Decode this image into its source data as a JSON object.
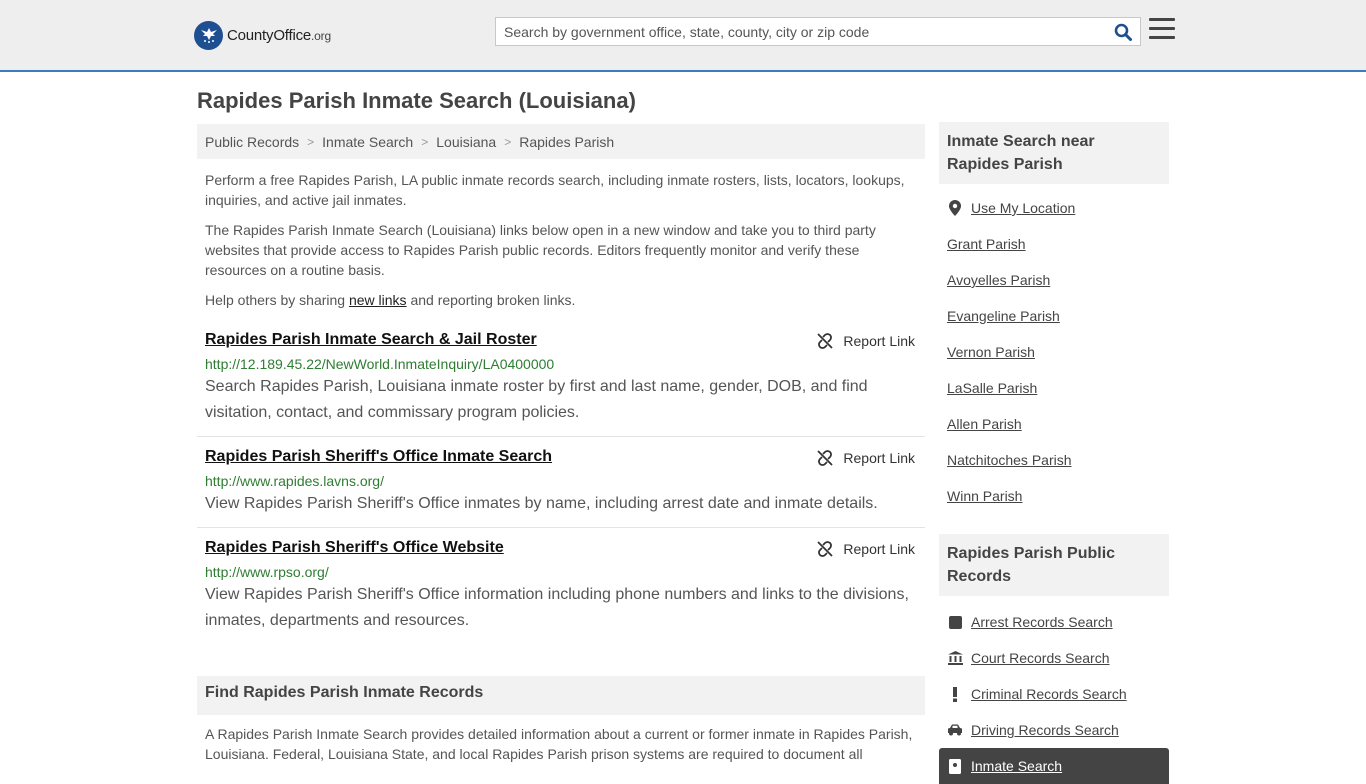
{
  "header": {
    "logo_main": "CountyOffice",
    "logo_tld": ".org",
    "search_placeholder": "Search by government office, state, county, city or zip code"
  },
  "page_title": "Rapides Parish Inmate Search (Louisiana)",
  "breadcrumb": [
    "Public Records",
    "Inmate Search",
    "Louisiana",
    "Rapides Parish"
  ],
  "intro": {
    "p1": "Perform a free Rapides Parish, LA public inmate records search, including inmate rosters, lists, locators, lookups, inquiries, and active jail inmates.",
    "p2": "The Rapides Parish Inmate Search (Louisiana) links below open in a new window and take you to third party websites that provide access to Rapides Parish public records. Editors frequently monitor and verify these resources on a routine basis.",
    "p3_before": "Help others by sharing ",
    "p3_link": "new links",
    "p3_after": " and reporting broken links."
  },
  "report_label": "Report Link",
  "results": [
    {
      "title": "Rapides Parish Inmate Search & Jail Roster",
      "url": "http://12.189.45.22/NewWorld.InmateInquiry/LA0400000",
      "desc": "Search Rapides Parish, Louisiana inmate roster by first and last name, gender, DOB, and find visitation, contact, and commissary program policies."
    },
    {
      "title": "Rapides Parish Sheriff's Office Inmate Search",
      "url": "http://www.rapides.lavns.org/",
      "desc": "View Rapides Parish Sheriff's Office inmates by name, including arrest date and inmate details."
    },
    {
      "title": "Rapides Parish Sheriff's Office Website",
      "url": "http://www.rpso.org/",
      "desc": "View Rapides Parish Sheriff's Office information including phone numbers and links to the divisions, inmates, departments and resources."
    }
  ],
  "find_section": {
    "heading": "Find Rapides Parish Inmate Records",
    "body": "A Rapides Parish Inmate Search provides detailed information about a current or former inmate in Rapides Parish, Louisiana. Federal, Louisiana State, and local Rapides Parish prison systems are required to document all"
  },
  "sidebar": {
    "nearby_heading": "Inmate Search near Rapides Parish",
    "use_location": "Use My Location",
    "nearby": [
      "Grant Parish",
      "Avoyelles Parish",
      "Evangeline Parish",
      "Vernon Parish",
      "LaSalle Parish",
      "Allen Parish",
      "Natchitoches Parish",
      "Winn Parish"
    ],
    "records_heading": "Rapides Parish Public Records",
    "records": [
      {
        "label": "Arrest Records Search",
        "icon": "square-icon"
      },
      {
        "label": "Court Records Search",
        "icon": "courthouse-icon"
      },
      {
        "label": "Criminal Records Search",
        "icon": "exclamation-icon"
      },
      {
        "label": "Driving Records Search",
        "icon": "car-icon"
      },
      {
        "label": "Inmate Search",
        "icon": "id-badge-icon"
      }
    ]
  }
}
